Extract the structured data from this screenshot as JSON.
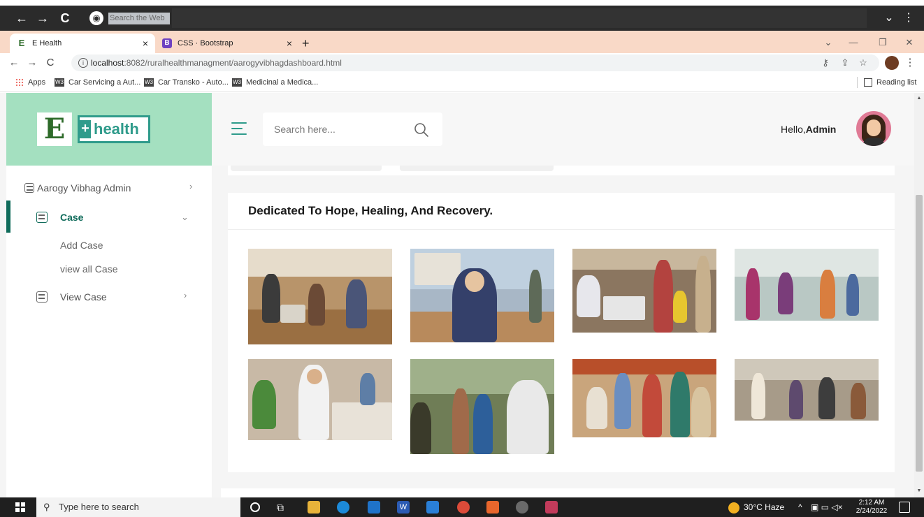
{
  "browser": {
    "web_search_placeholder": "Search the Web",
    "tabs": [
      {
        "title": "E Health",
        "favicon": "E",
        "close": "×"
      },
      {
        "title": "CSS · Bootstrap",
        "favicon": "B",
        "close": "×"
      }
    ],
    "new_tab": "+",
    "url_host": "localhost",
    "url_rest": ":8082/ruralhealthmanagment/aarogyvibhagdashboard.html",
    "bookmarks": {
      "apps": "Apps",
      "items": [
        "Car Servicing a Aut...",
        "Car Transko - Auto...",
        "Medicinal a Medica..."
      ],
      "w3_badge": "W3",
      "reading_list": "Reading list"
    }
  },
  "app": {
    "logo": {
      "mark": "E",
      "plus": "+",
      "text": "health"
    },
    "search": {
      "placeholder": "Search here..."
    },
    "greeting": {
      "prefix": "Hello,",
      "name": "Admin"
    },
    "sidebar": {
      "section": "Aarogy Vibhag Admin",
      "case": "Case",
      "add_case": "Add Case",
      "view_all_case": "view all Case",
      "view_case": "View Case"
    },
    "content": {
      "title": "Dedicated To Hope, Healing, And Recovery."
    },
    "colors": {
      "accent": "#2f9b8b",
      "logo_bg": "#a4e0c0",
      "active_bar": "#0f6b5a"
    }
  },
  "taskbar": {
    "search_placeholder": "Type here to search",
    "weather": "30°C Haze",
    "time": "2:12 AM",
    "date": "2/24/2022"
  }
}
